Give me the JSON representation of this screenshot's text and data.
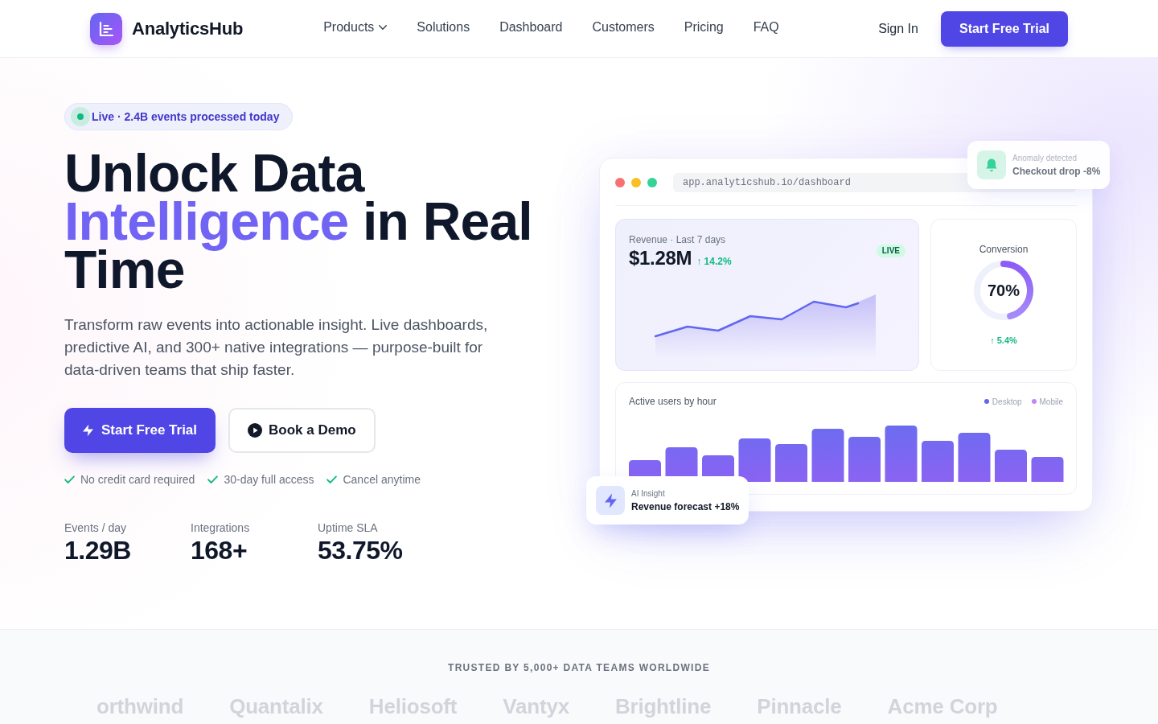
{
  "header": {
    "brand": "AnalyticsHub",
    "nav": [
      {
        "label": "Products",
        "has_menu": true
      },
      {
        "label": "Solutions",
        "has_menu": false
      },
      {
        "label": "Dashboard",
        "has_menu": false
      },
      {
        "label": "Customers",
        "has_menu": false
      },
      {
        "label": "Pricing",
        "has_menu": false
      },
      {
        "label": "FAQ",
        "has_menu": false
      }
    ],
    "sign_in": "Sign In",
    "cta": "Start Free Trial"
  },
  "hero": {
    "badge": "Live · 2.4B events processed today",
    "headline": [
      {
        "text": "Unlock Data",
        "accent": false
      },
      {
        "text": "Intelligence",
        "accent": true
      },
      {
        "text": "in Real Time",
        "accent": false
      }
    ],
    "lead": "Transform raw events into actionable insight. Live dashboards, predictive AI, and 300+ native integrations — purpose-built for data-driven teams that ship faster.",
    "buttons": [
      {
        "label": "Start Free Trial",
        "kind": "primary"
      },
      {
        "label": "Book a Demo",
        "kind": "secondary"
      }
    ],
    "perks": [
      "No credit card required",
      "30-day full access",
      "Cancel anytime"
    ],
    "stats": [
      {
        "label": "Events / day",
        "value": "1.29B"
      },
      {
        "label": "Integrations",
        "value": "168+"
      },
      {
        "label": "Uptime SLA",
        "value": "53.75%"
      }
    ]
  },
  "preview": {
    "url": "app.analyticshub.io/dashboard",
    "revenue": {
      "label": "Revenue · Last 7 days",
      "value": "$1.28M",
      "change": "↑ 14.2%",
      "tag": "LIVE"
    },
    "conversion": {
      "label": "Conversion",
      "value": "70%",
      "level": 0.46,
      "change": "↑ 5.4%"
    },
    "active_users": {
      "title": "Active users by hour",
      "legend": [
        {
          "label": "Desktop",
          "color": "#6366f1"
        },
        {
          "label": "Mobile",
          "color": "#c084fc"
        }
      ]
    },
    "insight": {
      "label": "AI Insight",
      "text": "Revenue forecast +18%"
    },
    "anomaly": {
      "label": "Anomaly detected",
      "text": "Checkout drop -8%"
    }
  },
  "trusted": {
    "heading": "TRUSTED BY 5,000+ DATA TEAMS WORLDWIDE",
    "logos": [
      "orthwind",
      "Quantalix",
      "Heliosoft",
      "Vantyx",
      "Brightline",
      "Pinnacle",
      "Acme Corp"
    ]
  }
}
